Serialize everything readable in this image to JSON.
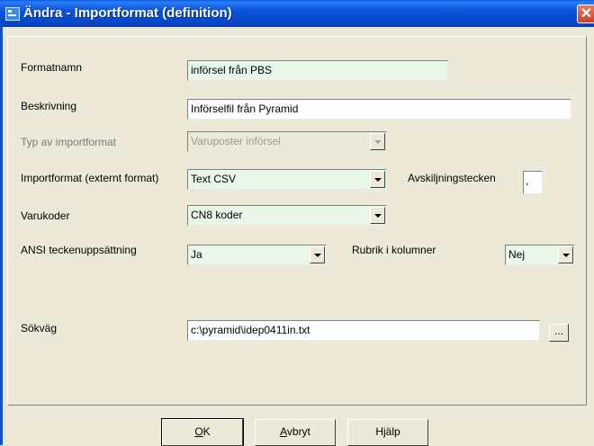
{
  "window": {
    "title": "Ändra - Importformat (definition)",
    "close_glyph": "✕"
  },
  "form": {
    "formatnamn": {
      "label": "Formatnamn",
      "value": "införsel från PBS"
    },
    "beskrivning": {
      "label": "Beskrivning",
      "value": "Införselfil från Pyramid"
    },
    "typ": {
      "label": "Typ av importformat",
      "value": "Varuposter införsel"
    },
    "importformat": {
      "label": "Importformat (externt format)",
      "value": "Text CSV"
    },
    "avskiljningstecken": {
      "label": "Avskiljningstecken",
      "value": ","
    },
    "varukoder": {
      "label": "Varukoder",
      "value": "CN8 koder"
    },
    "ansi": {
      "label": "ANSI teckenuppsättning",
      "value": "Ja"
    },
    "rubrik": {
      "label": "Rubrik i kolumner",
      "value": "Nej"
    },
    "sokvag": {
      "label": "Sökväg",
      "value": "c:\\pyramid\\idep0411in.txt",
      "browse_label": "..."
    }
  },
  "buttons": {
    "ok": {
      "mnemonic": "O",
      "rest": "K"
    },
    "cancel": {
      "mnemonic": "A",
      "rest": "vbryt"
    },
    "help": {
      "label": "Hjälp"
    }
  }
}
